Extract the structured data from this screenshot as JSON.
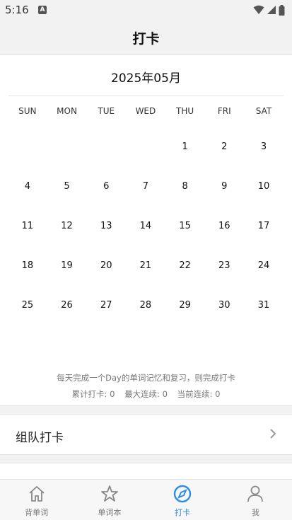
{
  "status_bar": {
    "time": "5:16",
    "notif": "A"
  },
  "header": {
    "title": "打卡"
  },
  "calendar": {
    "month": "2025年05月",
    "weekdays": [
      "SUN",
      "MON",
      "TUE",
      "WED",
      "THU",
      "FRI",
      "SAT"
    ],
    "days": [
      "",
      "",
      "",
      "",
      "1",
      "2",
      "3",
      "4",
      "5",
      "6",
      "7",
      "8",
      "9",
      "10",
      "11",
      "12",
      "13",
      "14",
      "15",
      "16",
      "17",
      "18",
      "19",
      "20",
      "21",
      "22",
      "23",
      "24",
      "25",
      "26",
      "27",
      "28",
      "29",
      "30",
      "31"
    ]
  },
  "tip": "每天完成一个Day的单词记忆和复习，则完成打卡",
  "stats": {
    "total": "累计打卡: 0",
    "max_streak": "最大连续: 0",
    "current_streak": "当前连续: 0"
  },
  "rows": {
    "team": "组队打卡"
  },
  "bottom_nav": {
    "items": [
      {
        "label": "背单词",
        "icon": "home-icon"
      },
      {
        "label": "单词本",
        "icon": "star-icon"
      },
      {
        "label": "打卡",
        "icon": "compass-icon"
      },
      {
        "label": "我",
        "icon": "person-icon"
      }
    ],
    "active_index": 2,
    "active_color": "#2b8de3"
  }
}
